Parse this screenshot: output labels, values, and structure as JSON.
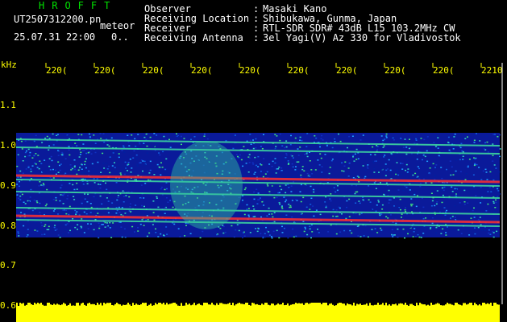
{
  "header": {
    "title": "HROFFT",
    "filename": "UT2507312200.pn",
    "meteor_label": "meteor",
    "datetime": "25.07.31 22:00",
    "dots": "0..",
    "fields": [
      {
        "label": "Observer",
        "value": "Masaki Kano"
      },
      {
        "label": "Receiving Location",
        "value": "Shibukawa, Gunma, Japan"
      },
      {
        "label": "Receiver",
        "value": "RTL-SDR SDR# 43dB L15 103.2MHz CW"
      },
      {
        "label": "Receiving Antenna",
        "value": "3el Yagi(V) Az 330 for Vladivostok"
      }
    ],
    "colon": ":"
  },
  "axes": {
    "y_unit": "kHz",
    "y_ticks": [
      "1.1",
      "1.0",
      "0.9",
      "0.8",
      "0.7",
      "0.6"
    ],
    "x_ticks": [
      "220(",
      "220(",
      "220(",
      "220(",
      "220(",
      "220(",
      "220(",
      "220(",
      "220(",
      "2210"
    ]
  },
  "colors": {
    "background": "#000000",
    "label_text": "#ffffff",
    "axis_text": "#ffff00",
    "title": "#00e000",
    "tick": "#ffff00",
    "level_bar": "#ffff00",
    "noise": "#0a1a9a",
    "band_hot": "#ff3030"
  },
  "spectrogram": {
    "freq_range_khz": [
      0.6,
      1.1
    ],
    "traces_khz": [
      1.01,
      0.99,
      0.92,
      0.91,
      0.88,
      0.84,
      0.82,
      0.81
    ],
    "noise_band_khz": [
      0.77,
      1.03
    ]
  }
}
